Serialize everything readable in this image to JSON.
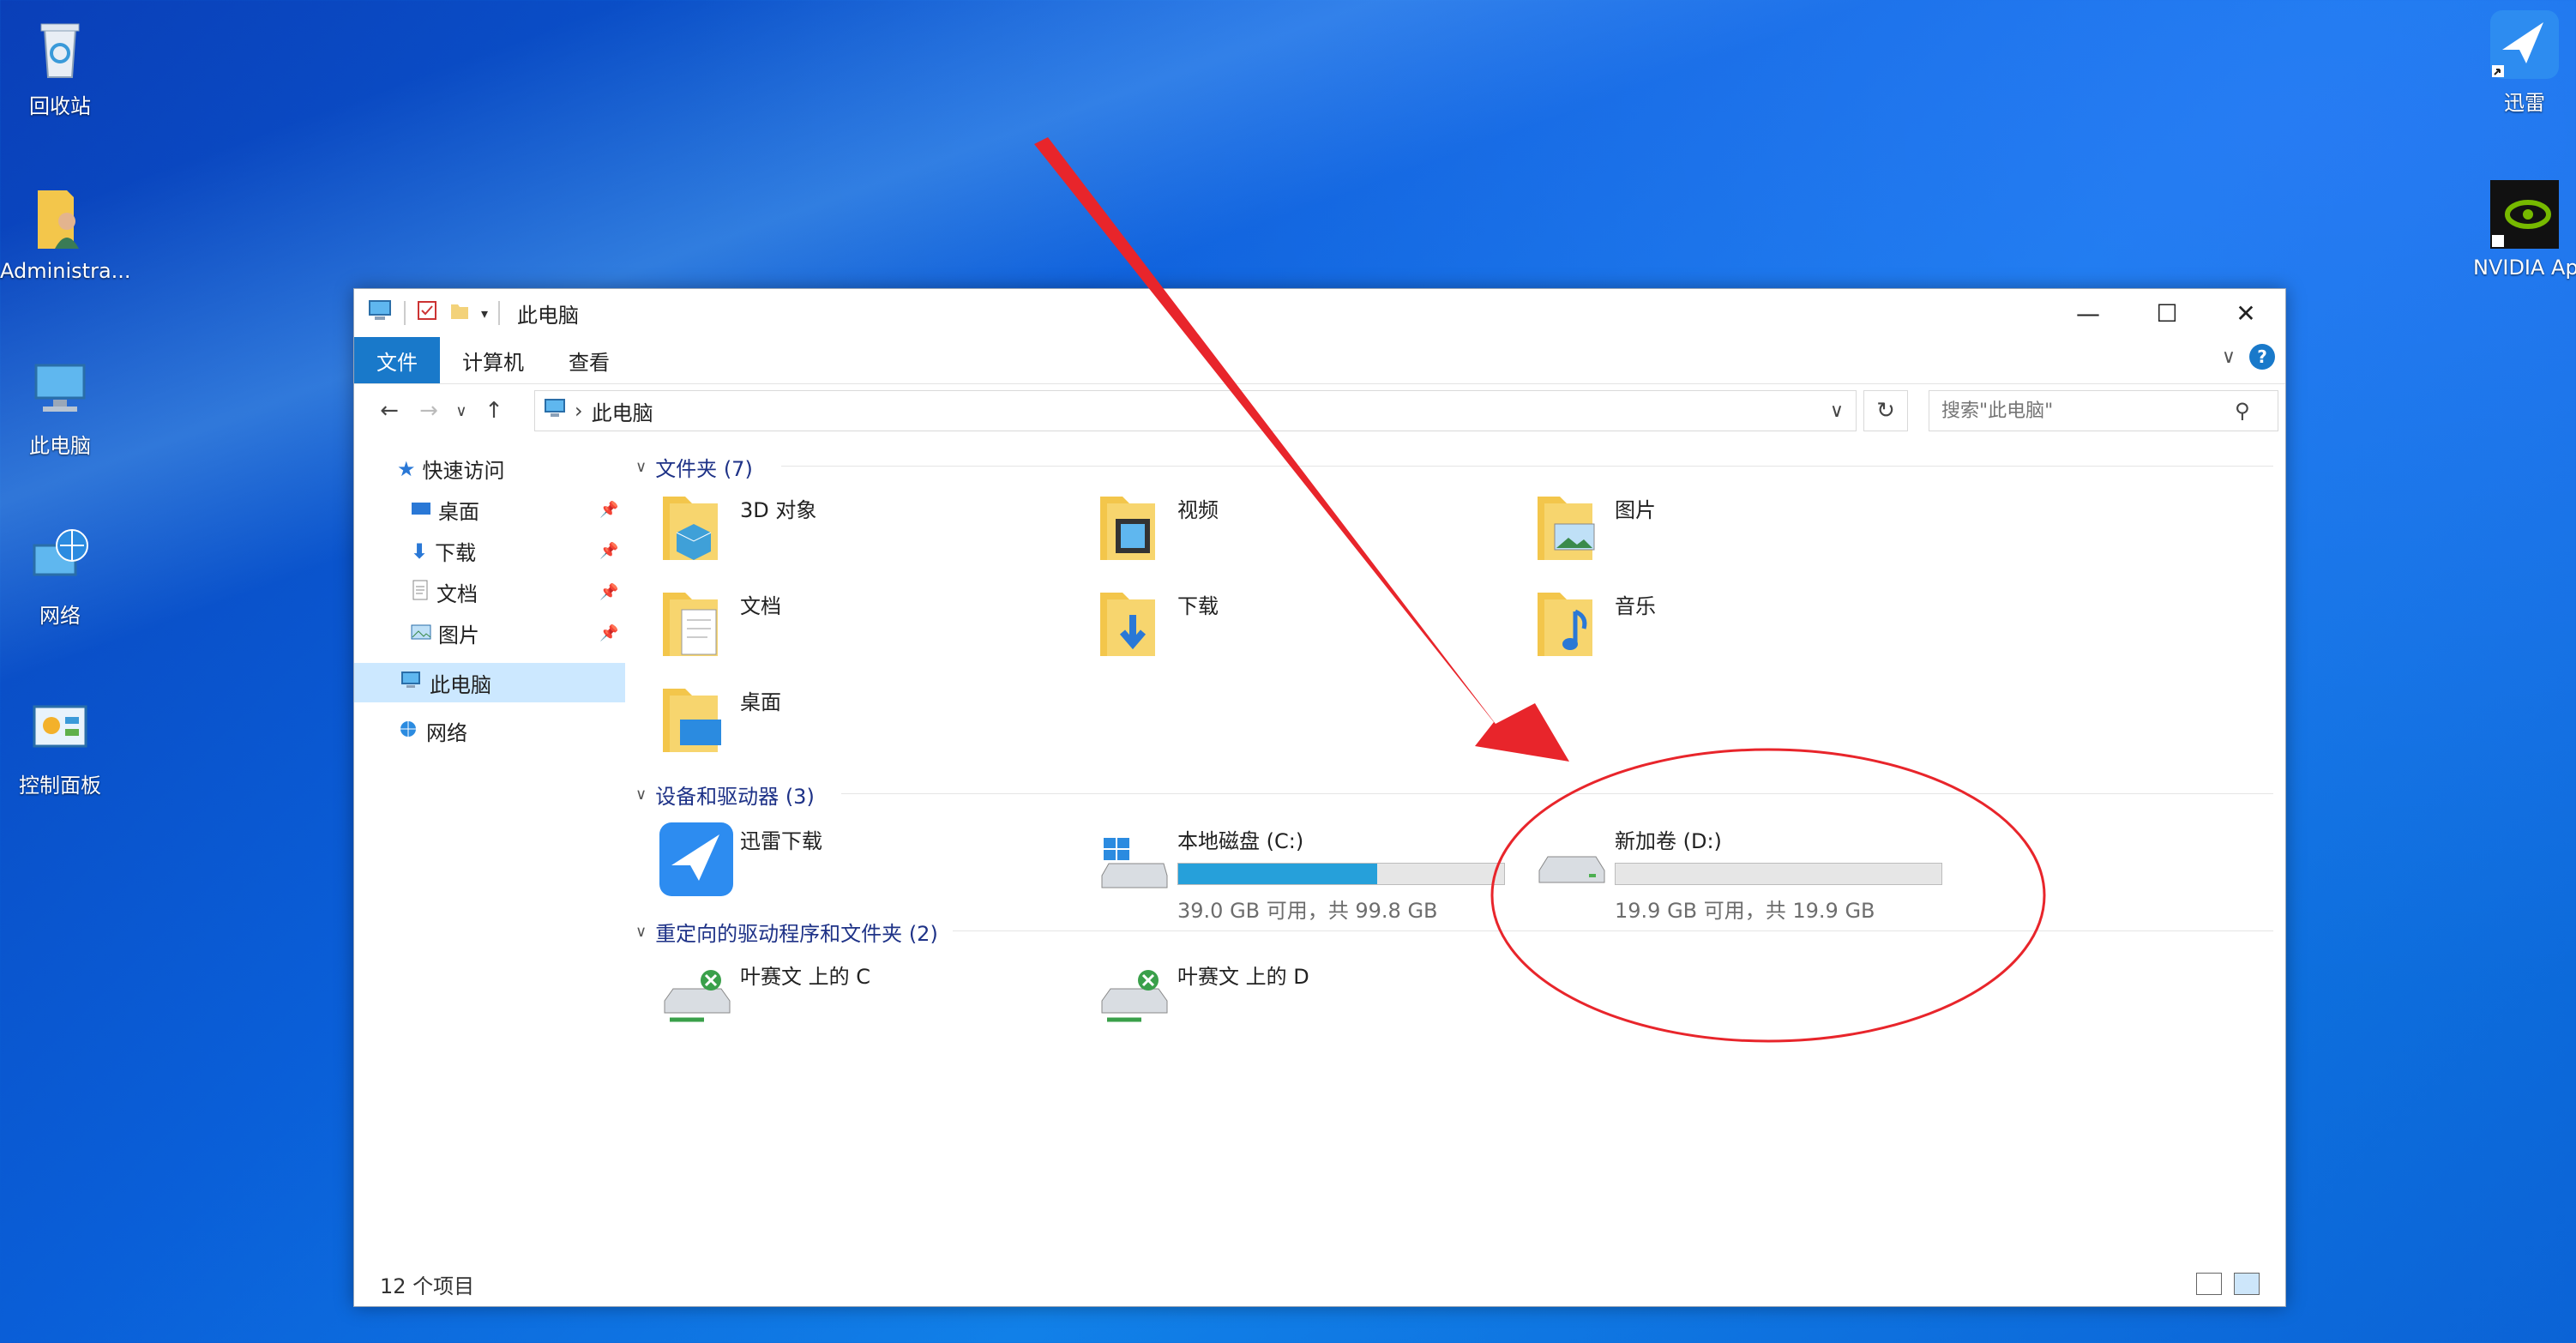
{
  "desktop": {
    "icons": [
      {
        "label": "回收站",
        "icon": "recycle-bin-icon"
      },
      {
        "label": "Administra...",
        "icon": "user-folder-icon"
      },
      {
        "label": "此电脑",
        "icon": "computer-icon"
      },
      {
        "label": "网络",
        "icon": "network-icon"
      },
      {
        "label": "控制面板",
        "icon": "control-panel-icon"
      }
    ],
    "right_icons": [
      {
        "label": "迅雷",
        "icon": "xunlei-bird-icon"
      },
      {
        "label": "NVIDIA Ap",
        "icon": "nvidia-icon"
      }
    ]
  },
  "window": {
    "title": "此电脑",
    "tabs": [
      "文件",
      "计算机",
      "查看"
    ],
    "controls": {
      "minimize": "—",
      "maximize": "☐",
      "close": "✕"
    },
    "address": {
      "crumb": "此电脑"
    },
    "search_placeholder": "搜索\"此电脑\"",
    "nav": {
      "quick_access": "快速访问",
      "items": [
        {
          "label": "桌面",
          "icon": "desktop-icon"
        },
        {
          "label": "下载",
          "icon": "download-icon"
        },
        {
          "label": "文档",
          "icon": "document-icon"
        },
        {
          "label": "图片",
          "icon": "picture-icon"
        }
      ],
      "this_pc": "此电脑",
      "network": "网络"
    },
    "groups": {
      "folders": {
        "header": "文件夹 (7)",
        "items": [
          "3D 对象",
          "视频",
          "图片",
          "文档",
          "下载",
          "音乐",
          "桌面"
        ]
      },
      "devices": {
        "header": "设备和驱动器 (3)",
        "app": "迅雷下载",
        "drives": [
          {
            "name": "本地磁盘 (C:)",
            "free": "39.0 GB 可用，共 99.8 GB",
            "used_fraction": 0.61
          },
          {
            "name": "新加卷 (D:)",
            "free": "19.9 GB 可用，共 19.9 GB",
            "used_fraction": 0.0
          }
        ]
      },
      "redirected": {
        "header": "重定向的驱动程序和文件夹 (2)",
        "items": [
          "叶赛文 上的 C",
          "叶赛文 上的 D"
        ]
      }
    },
    "status": {
      "count": "12 个项目"
    }
  },
  "annotation": {
    "color": "#e8252b"
  }
}
